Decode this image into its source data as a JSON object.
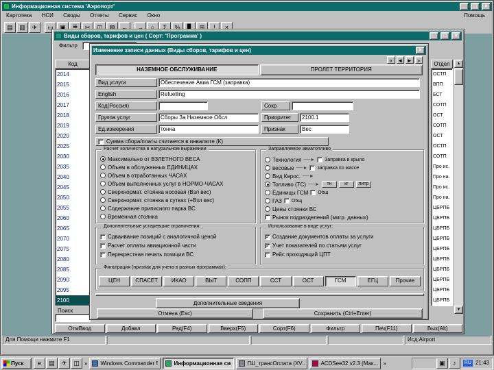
{
  "app": {
    "title": "Информационная система 'Аэропорт'",
    "menu": [
      "Картотека",
      "НСИ",
      "Своды",
      "Отчеты",
      "Сервис",
      "Окно"
    ],
    "menu_help": "Помощь",
    "window_buttons": {
      "minimize": "_",
      "maximize": "□",
      "close": "×"
    },
    "toolbar_a": [
      {
        "label": "▤"
      },
      {
        "label": "▥"
      },
      {
        "label": "✈"
      }
    ],
    "toolbar_b": [
      {
        "label": "▭"
      },
      {
        "label": "▣"
      },
      {
        "label": "≣"
      },
      {
        "label": "✂"
      },
      {
        "label": "◫"
      },
      {
        "label": "▧"
      },
      {
        "label": "←"
      }
    ],
    "toolbar_c": [
      {
        "label": "→"
      },
      {
        "label": "○"
      },
      {
        "label": "Σ"
      },
      {
        "label": "%"
      },
      {
        "label": "▊"
      },
      {
        "label": "⊞"
      },
      {
        "label": "!"
      },
      {
        "label": "×"
      }
    ],
    "statusbar": {
      "help": "Для Помощи нажмите F1",
      "app_id": "Исд:Airport"
    }
  },
  "browse": {
    "title": "Виды сборов, тарифов и цен ( Сорт: 'Программа' )",
    "filter_label": "Фильтр",
    "col_code": "Код",
    "col_dept": "Отдел",
    "search_label": "Поиск",
    "rows": [
      "2014",
      "2015",
      "2016",
      "2017",
      "2018",
      "2019",
      "2020",
      "2025",
      "2030",
      "2035",
      "2040",
      "2045",
      "2050",
      "2055",
      "2060",
      "2065",
      "2070",
      "2075",
      "2080",
      "2085",
      "2090",
      "2095",
      {
        "label": "2100",
        "selected": true
      }
    ],
    "dept_rows": [
      "ОСТП",
      "ВПП",
      "БСТ",
      "СОТП",
      "ОСТ",
      "СОТП",
      "ОСТ",
      "ОСТП",
      "СОТП",
      "Про ис.",
      "Про на.",
      "Про ис.",
      "Про на.",
      "ЦБРПБ",
      "ЦБРПБ",
      "ЦБРПБ",
      "ЦБРПБ",
      "ЦБРПБ",
      "ЦБРПБ",
      "ЦБРПБ",
      "ЦБРПБ",
      "ЦБРПБ",
      "ЦБРПБ"
    ],
    "buttons": [
      {
        "label": "ОтмВвод"
      },
      {
        "label": "Добавл"
      },
      {
        "label": "Ред(F4)"
      },
      {
        "label": "Вверх(F5)"
      },
      {
        "label": "Сорт(F6)"
      },
      {
        "label": "Фильтр"
      },
      {
        "label": "Печ(F11)"
      },
      {
        "label": "Вых(Alt)"
      }
    ]
  },
  "dialog": {
    "title": "Изменение записи данных (Виды сборов, тарифов и цен)",
    "nav": [
      {
        "label": "«"
      },
      {
        "label": "◄"
      },
      {
        "label": "►"
      },
      {
        "label": "»"
      }
    ],
    "tabs": [
      {
        "label": "НАЗЕМНОЕ ОБСЛУЖИВАНИЕ",
        "active": true
      },
      {
        "label": "ПРОЛЕТ ТЕРРИТОРИЯ",
        "active": false
      }
    ],
    "fields": {
      "service_label": "Вид услуги",
      "service_value": "Обеспечение Авиа ГСМ (заправка)",
      "english_label": "English",
      "english_value": "Refuelling",
      "code_label": "Код(Россия)",
      "code_value": "",
      "abbr_label": "Сокр",
      "abbr_value": "",
      "group_label": "Группа услуг",
      "group_value": "Сборы За Наземное Обсл",
      "priority_label": "Приоритет",
      "priority_value": "2100.1",
      "unit_label": "Ед.измерения",
      "unit_value": "тонна",
      "sign_label": "Признак",
      "sign_value": "Вес"
    },
    "currency_check": {
      "label": "Сумма сбора/платы считается в инвалюте (К)",
      "checked": false
    },
    "qty_group": {
      "title": "Расчет количества в натуральном выражении",
      "options": [
        {
          "label": "Максимально от ВЗЛЕТНОГО ВЕСА",
          "checked": true
        },
        {
          "label": "Объем в обслуженных ЕДИНИЦАХ"
        },
        {
          "label": "Объем в отработанных ЧАСАХ"
        },
        {
          "label": "Объем выполненных услуг в НОРМО-ЧАСАХ"
        },
        {
          "label": "Сверхнормат. стоянка носовая (Взл вес)"
        },
        {
          "label": "Сверхнормат. стоянка в сутках (+Взл вес)"
        },
        {
          "label": "Содержание приписного парка ВС"
        },
        {
          "label": "Временная стоянка"
        }
      ]
    },
    "fuel_group": {
      "title": "Заправляемое авиатопливо",
      "rows": [
        {
          "label": "Технология",
          "right": "Заправка в крыло"
        },
        {
          "label": "весовые",
          "right": "заправка по массе"
        },
        {
          "label": "Вид Керос."
        },
        {
          "label": "Топливо (ТС)",
          "selected": true,
          "units": [
            "тн",
            "кг",
            "литр"
          ]
        },
        {
          "label": "Единицы ГСМ",
          "right": "Общ"
        },
        {
          "label": "ГАЗ",
          "right": "Общ"
        },
        {
          "label": "Цены стоянки ВС"
        },
        {
          "label": "Рынок подразделений (мигр. данных)"
        }
      ]
    },
    "restrict_group": {
      "title": "Дополнительные устаревшие ограничения:",
      "options": [
        {
          "label": "Сдваивание позиций с аналогичной ценой"
        },
        {
          "label": "Расчет оплаты авиационной части"
        },
        {
          "label": "Перекрестная печать позиции ВС"
        }
      ]
    },
    "usage_group": {
      "title": "Использование в виде услуг:",
      "options": [
        {
          "label": "Создание документов оплаты за услуги",
          "checked": true
        },
        {
          "label": "Учет показателей по статьям услуг",
          "checked": true
        },
        {
          "label": "Рейс проходящий ЦПТ"
        }
      ]
    },
    "filter_group": {
      "title": "Фильтрация (признак для учета в разных программах):",
      "buttons": [
        {
          "label": "ЦЕН"
        },
        {
          "label": "СПАСЕТ"
        },
        {
          "label": "ИКАО"
        },
        {
          "label": "ВЫТ"
        },
        {
          "label": "СОПП"
        },
        {
          "label": "ССТ"
        },
        {
          "label": "ОСТ"
        },
        {
          "label": "ГСМ",
          "active": true
        },
        {
          "label": "ЕГЦ"
        },
        {
          "label": "Прочие"
        }
      ],
      "note": ""
    },
    "extra_button": "Дополнительные сведения",
    "cancel_button": "Отмена (Esc)",
    "save_button": "Сохранить (Ctrl+Enter)"
  },
  "taskbar": {
    "start": "Пуск",
    "quick": [
      {
        "label": "e"
      },
      {
        "label": "▤"
      },
      {
        "label": "✈"
      },
      {
        "label": "◫"
      }
    ],
    "chevron": "»",
    "tasks": [
      {
        "label": "Windows Commander 5.0"
      },
      {
        "label": "Информационная сис...",
        "active": true
      },
      {
        "label": "ГШ_трансОплата (XV..."
      },
      {
        "label": "ACDSee32 v2.3 (Мак..."
      }
    ],
    "tray": {
      "icons": [
        {
          "label": "▣"
        },
        {
          "label": "♪"
        }
      ],
      "lang": "RU",
      "time": "21:43"
    }
  }
}
